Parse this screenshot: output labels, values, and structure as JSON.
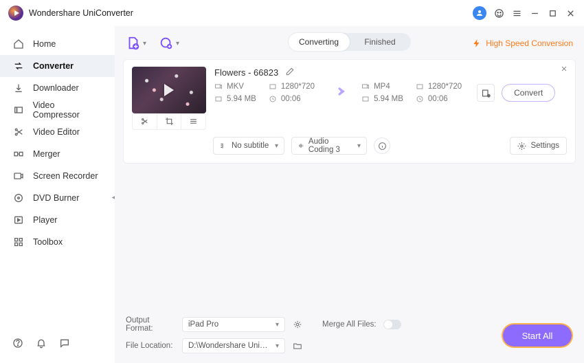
{
  "app": {
    "title": "Wondershare UniConverter"
  },
  "sidebar": {
    "items": [
      {
        "label": "Home"
      },
      {
        "label": "Converter"
      },
      {
        "label": "Downloader"
      },
      {
        "label": "Video Compressor"
      },
      {
        "label": "Video Editor"
      },
      {
        "label": "Merger"
      },
      {
        "label": "Screen Recorder"
      },
      {
        "label": "DVD Burner"
      },
      {
        "label": "Player"
      },
      {
        "label": "Toolbox"
      }
    ]
  },
  "tabs": {
    "converting": "Converting",
    "finished": "Finished"
  },
  "high_speed": "High Speed Conversion",
  "item": {
    "filename": "Flowers - 66823",
    "src": {
      "format": "MKV",
      "resolution": "1280*720",
      "size": "5.94 MB",
      "duration": "00:06"
    },
    "dst": {
      "format": "MP4",
      "resolution": "1280*720",
      "size": "5.94 MB",
      "duration": "00:06"
    },
    "subtitle": "No subtitle",
    "audio": "Audio Coding 3",
    "settings_label": "Settings",
    "convert_label": "Convert"
  },
  "footer": {
    "output_format_label": "Output Format:",
    "output_format_value": "iPad Pro",
    "file_location_label": "File Location:",
    "file_location_value": "D:\\Wondershare UniConverter",
    "merge_label": "Merge All Files:",
    "start_all": "Start All"
  }
}
